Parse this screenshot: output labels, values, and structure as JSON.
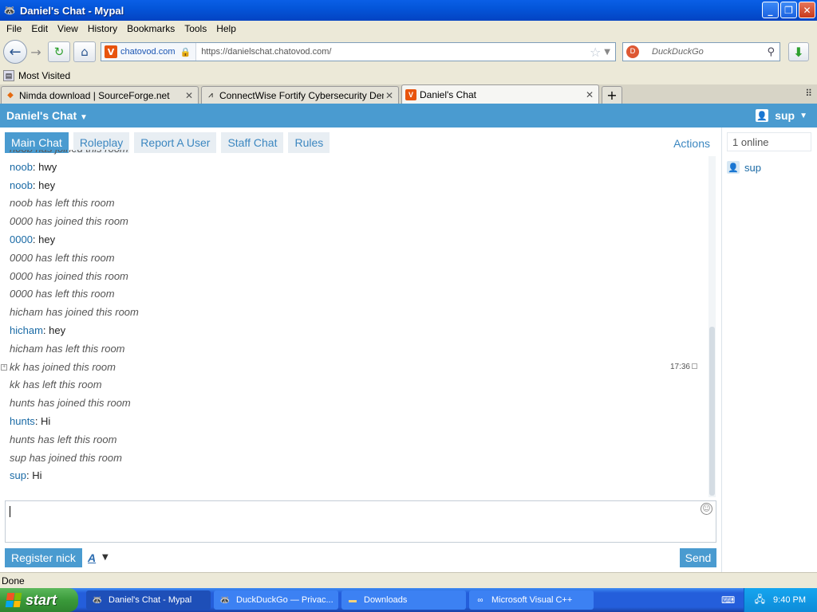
{
  "window": {
    "title": "Daniel's Chat - Mypal"
  },
  "menu": [
    "File",
    "Edit",
    "View",
    "History",
    "Bookmarks",
    "Tools",
    "Help"
  ],
  "nav": {
    "site_domain": "chatovod.com",
    "url": "https://danielschat.chatovod.com/",
    "search_placeholder": "DuckDuckGo"
  },
  "bookmarks": {
    "most_visited": "Most Visited"
  },
  "tabs": [
    {
      "label": "Nimda download | SourceForge.net"
    },
    {
      "label": "ConnectWise Fortify Cybersecurity Demo"
    },
    {
      "label": "Daniel's Chat"
    }
  ],
  "header": {
    "room_title": "Daniel's Chat",
    "user": "sup"
  },
  "room_tabs": [
    "Main Chat",
    "Roleplay",
    "Report A User",
    "Staff Chat",
    "Rules"
  ],
  "actions_label": "Actions",
  "messages": [
    {
      "type": "sys",
      "text": "noob has joined this room"
    },
    {
      "type": "msg",
      "nick": "noob",
      "text": "hwy"
    },
    {
      "type": "msg",
      "nick": "noob",
      "text": "hey"
    },
    {
      "type": "sys",
      "text": "noob has left this room"
    },
    {
      "type": "sys",
      "text": "0000 has joined this room"
    },
    {
      "type": "msg",
      "nick": "0000",
      "text": "hey"
    },
    {
      "type": "sys",
      "text": "0000 has left this room"
    },
    {
      "type": "sys",
      "text": "0000 has joined this room"
    },
    {
      "type": "sys",
      "text": "0000 has left this room"
    },
    {
      "type": "sys",
      "text": "hicham has joined this room"
    },
    {
      "type": "msg",
      "nick": "hicham",
      "text": "hey"
    },
    {
      "type": "sys",
      "text": "hicham has left this room"
    },
    {
      "type": "sys",
      "text": "kk has joined this room",
      "time": "17:36"
    },
    {
      "type": "sys",
      "text": "kk has left this room"
    },
    {
      "type": "sys",
      "text": "hunts has joined this room"
    },
    {
      "type": "msg",
      "nick": "hunts",
      "text": "Hi"
    },
    {
      "type": "sys",
      "text": "hunts has left this room"
    },
    {
      "type": "sys",
      "text": "sup has joined this room"
    },
    {
      "type": "msg",
      "nick": "sup",
      "text": "Hi"
    }
  ],
  "compose": {
    "register_label": "Register nick",
    "font_label": "A",
    "send_label": "Send"
  },
  "sidebar": {
    "online_count": "1 online",
    "users": [
      "sup"
    ]
  },
  "status": {
    "text": "Done"
  },
  "taskbar": {
    "start_label": "start",
    "items": [
      {
        "label": "Daniel's Chat - Mypal"
      },
      {
        "label": "DuckDuckGo — Privac..."
      },
      {
        "label": "Downloads"
      },
      {
        "label": "Microsoft Visual C++"
      }
    ],
    "clock": "9:40 PM"
  },
  "colors": {
    "accent": "#4a9bd0",
    "nick": "#1a6aa5",
    "titlebar": "#0455d9"
  }
}
